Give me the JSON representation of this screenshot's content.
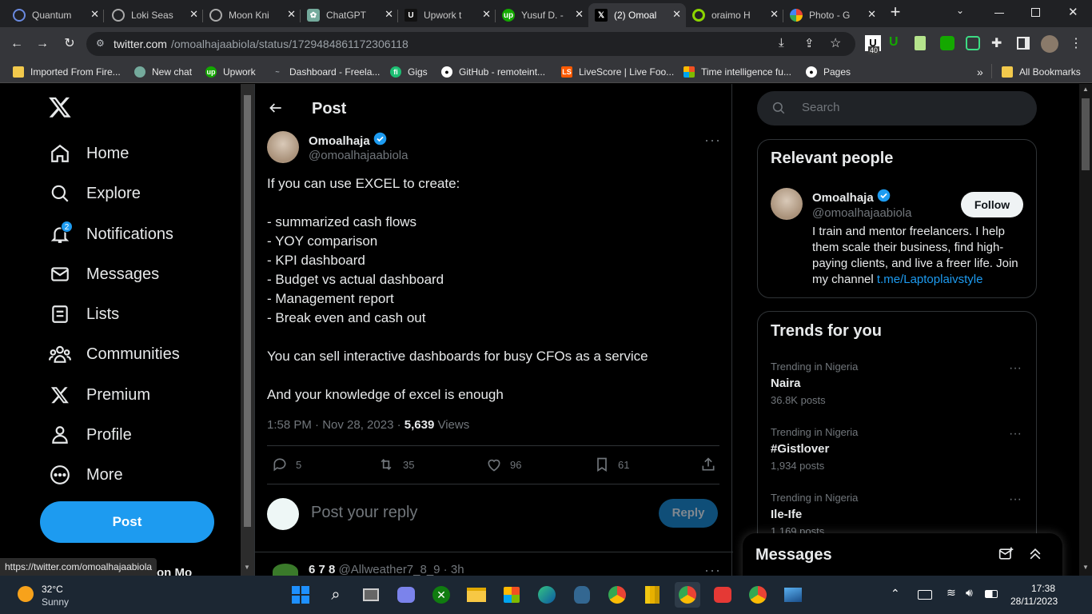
{
  "browser": {
    "tabs": [
      {
        "label": "Quantum",
        "color": "#4a6cd4"
      },
      {
        "label": "Loki Seas",
        "color": "#7a7a9a"
      },
      {
        "label": "Moon Kni",
        "color": "#6a6a8a"
      },
      {
        "label": "ChatGPT",
        "color": "#74aa9c"
      },
      {
        "label": "Upwork t",
        "color": "#111111"
      },
      {
        "label": "Yusuf D. -",
        "color": "#14a800"
      },
      {
        "label": "(2) Omoal",
        "color": "#000000",
        "active": true
      },
      {
        "label": "oraimo H",
        "color": "#8cd400"
      },
      {
        "label": "Photo - G",
        "color": "#ea4335"
      }
    ],
    "new_tab": "+",
    "url_domain": "twitter.com",
    "url_path": "/omoalhajaabiola/status/1729484861172306118",
    "bookmarks": [
      "Imported From Fire...",
      "New chat",
      "Upwork",
      "Dashboard - Freela...",
      "Gigs",
      "GitHub - remoteint...",
      "LiveScore | Live Foo...",
      "Time intelligence fu...",
      "Pages"
    ],
    "all_bookmarks": "All Bookmarks",
    "ext_badge": "40",
    "status_url": "https://twitter.com/omoalhajaabiola"
  },
  "nav": {
    "items": [
      "Home",
      "Explore",
      "Notifications",
      "Messages",
      "Lists",
      "Communities",
      "Premium",
      "Profile",
      "More"
    ],
    "notif_badge": "2",
    "post_button": "Post",
    "account_partial": "on Mo"
  },
  "post": {
    "header": "Post",
    "author_name": "Omoalhaja",
    "author_handle": "@omoalhajaabiola",
    "lines": [
      "If you can use EXCEL to create:",
      "",
      "- summarized cash flows",
      "- YOY comparison",
      "- KPI dashboard",
      "- Budget vs actual dashboard",
      "- Management report",
      "- Break even and cash out",
      "",
      "You can sell interactive dashboards for busy CFOs as a service",
      "",
      "And your knowledge of excel is enough"
    ],
    "timestamp": "1:58 PM · Nov 28, 2023 ·",
    "views_count": "5,639",
    "views_label": "Views",
    "replies": "5",
    "reposts": "35",
    "likes": "96",
    "bookmarks": "61",
    "reply_placeholder": "Post your reply",
    "reply_button": "Reply",
    "next_reply_name": "6 7 8",
    "next_reply_handle": "@Allweather7_8_9 · 3h"
  },
  "search": {
    "placeholder": "Search"
  },
  "relevant": {
    "title": "Relevant people",
    "name": "Omoalhaja",
    "handle": "@omoalhajaabiola",
    "follow": "Follow",
    "bio": "I train and mentor freelancers. I help them scale their business, find high-paying clients, and live a freer life. Join my channel",
    "link": "t.me/Laptoplaivstyle"
  },
  "trends": {
    "title": "Trends for you",
    "items": [
      {
        "meta": "Trending in Nigeria",
        "name": "Naira",
        "count": "36.8K posts"
      },
      {
        "meta": "Trending in Nigeria",
        "name": "#Gistlover",
        "count": "1,934 posts"
      },
      {
        "meta": "Trending in Nigeria",
        "name": "Ile-Ife",
        "count": "1,169 posts"
      }
    ]
  },
  "messages_dock": {
    "title": "Messages"
  },
  "taskbar": {
    "temp": "32°C",
    "weather": "Sunny",
    "time": "17:38",
    "date": "28/11/2023"
  },
  "colors": {
    "accent": "#1d9bf0",
    "verified": "#1d9bf0"
  }
}
